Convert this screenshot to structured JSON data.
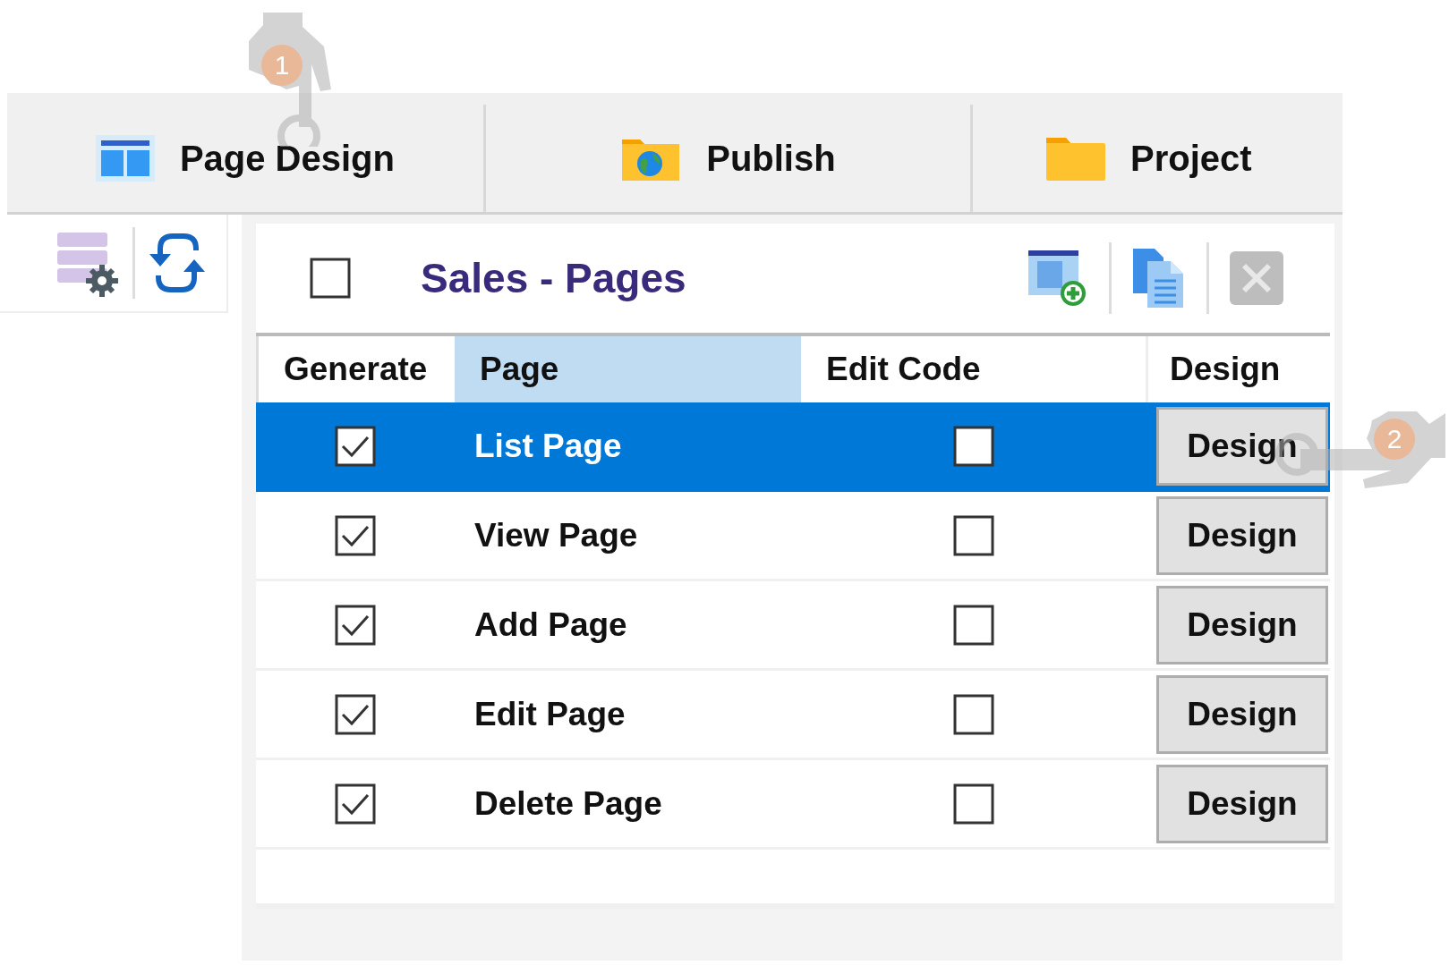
{
  "tabs": [
    {
      "label": "Page Design",
      "kind": "layout"
    },
    {
      "label": "Publish",
      "kind": "globe"
    },
    {
      "label": "Project",
      "kind": "folder"
    }
  ],
  "panel": {
    "select_all": {
      "checked": false
    },
    "title": "Sales - Pages"
  },
  "table": {
    "columns": [
      {
        "label": "Generate",
        "sorted": false
      },
      {
        "label": "Page",
        "sorted": true
      },
      {
        "label": "Edit Code",
        "sorted": false
      },
      {
        "label": "Design",
        "sorted": false
      }
    ],
    "rows": [
      {
        "generate": true,
        "page": "List Page",
        "edit_code": false,
        "design": "Design",
        "selected": true
      },
      {
        "generate": true,
        "page": "View Page",
        "edit_code": false,
        "design": "Design",
        "selected": false
      },
      {
        "generate": true,
        "page": "Add Page",
        "edit_code": false,
        "design": "Design",
        "selected": false
      },
      {
        "generate": true,
        "page": "Edit Page",
        "edit_code": false,
        "design": "Design",
        "selected": false
      },
      {
        "generate": true,
        "page": "Delete Page",
        "edit_code": false,
        "design": "Design",
        "selected": false
      }
    ]
  },
  "callouts": [
    {
      "label": "1",
      "kind": "down"
    },
    {
      "label": "2",
      "kind": "left"
    }
  ]
}
